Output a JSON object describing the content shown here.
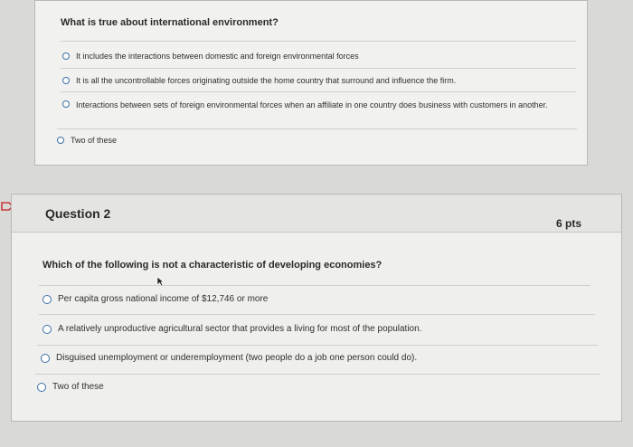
{
  "question1": {
    "prompt": "What is true about international environment?",
    "options": [
      {
        "label": "It includes the interactions between domestic and foreign environmental forces"
      },
      {
        "label": "It is all the uncontrollable forces originating outside the home country that surround and influence the firm."
      },
      {
        "label": "Interactions between sets of foreign environmental forces when an affiliate in one country does business with customers in another."
      },
      {
        "label": "Two of these"
      }
    ]
  },
  "question2": {
    "title": "Question 2",
    "points": "6 pts",
    "prompt": "Which of the following is not a characteristic of developing economies?",
    "options": [
      {
        "label": "Per capita gross national income of $12,746 or more"
      },
      {
        "label": "A relatively unproductive agricultural sector that provides a living for most of the population."
      },
      {
        "label": "Disguised unemployment or underemployment (two people do a job one person could do)."
      },
      {
        "label": "Two of these"
      }
    ]
  },
  "colors": {
    "radio_border": "#3a6ea8",
    "flag": "#c73b3b"
  }
}
